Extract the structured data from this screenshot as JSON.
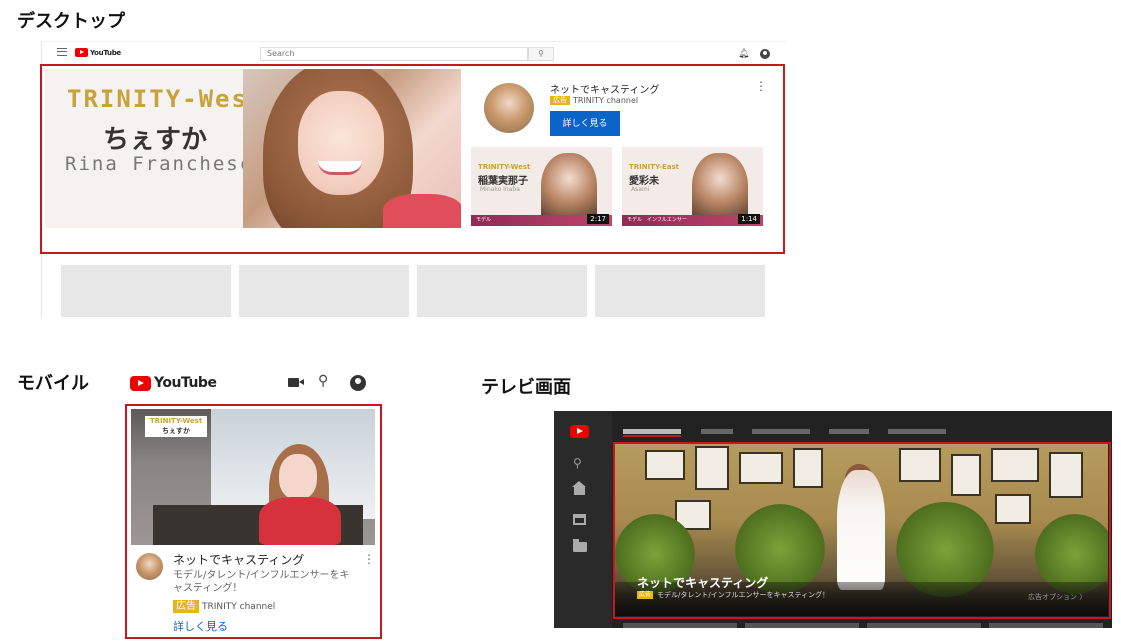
{
  "labels": {
    "desktop": "デスクトップ",
    "mobile": "モバイル",
    "tv": "テレビ画面"
  },
  "desktop": {
    "logo_text": "YouTube",
    "search_placeholder": "Search",
    "search_icon": "search-icon",
    "masthead": {
      "brand": "TRINITY-West",
      "name_jp": "ちぇすか",
      "name_en": "Rina Franchesca"
    },
    "ad": {
      "title": "ネットでキャスティング",
      "badge": "広告",
      "channel": "TRINITY channel",
      "cta": "詳しく見る",
      "more_icon": "⋮"
    },
    "thumbnails": [
      {
        "brand": "TRINITY-West",
        "name": "稲葉実那子",
        "roman": "Minako Inaba",
        "tag": "モデル",
        "duration": "2:17"
      },
      {
        "brand": "TRINITY-East",
        "name": "愛彩未",
        "roman": "Asami",
        "tag": "モデル　インフルエンサー",
        "duration": "1:14"
      }
    ]
  },
  "mobile": {
    "logo_text": "YouTube",
    "hero": {
      "brand": "TRINITY-West",
      "name": "ちぇすか"
    },
    "title": "ネットでキャスティング",
    "description": "モデル/タレント/インフルエンサーをキャスティング！",
    "badge": "広告",
    "channel": "TRINITY channel",
    "cta": "詳しく見る",
    "more_icon": "⋮"
  },
  "tv": {
    "title": "ネットでキャスティング",
    "badge": "広告",
    "description": "モデル/タレント/インフルエンサーをキャスティング！",
    "options": "広告オプション 〉"
  },
  "colors": {
    "highlight": "#c8181e",
    "badge": "#e7b51a",
    "cta": "#0b65c9",
    "youtube_red": "#ee0000"
  }
}
